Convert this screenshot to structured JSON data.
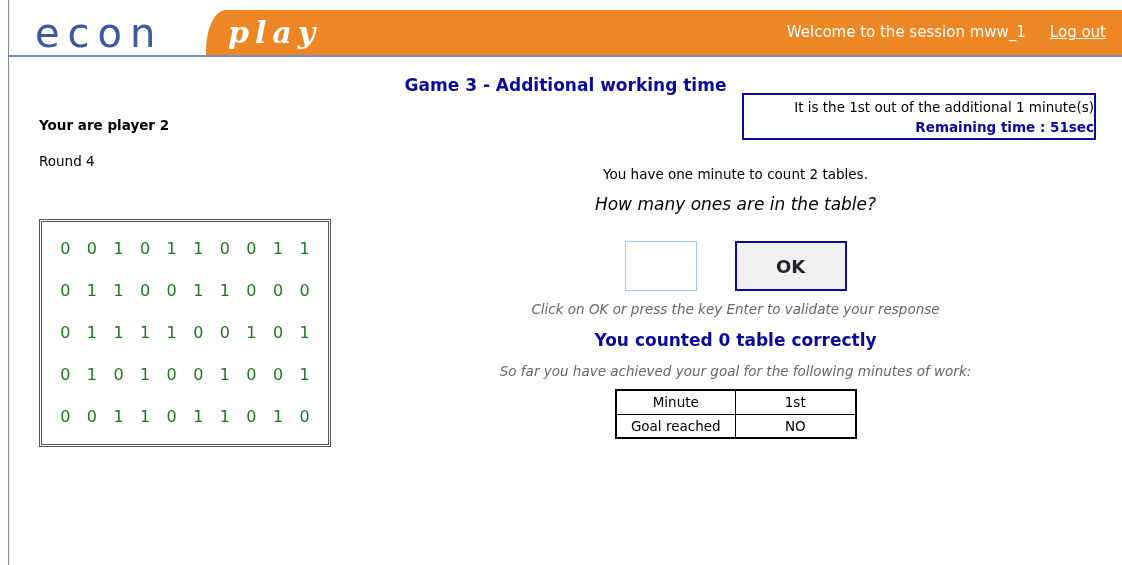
{
  "header": {
    "logo_left": "econ",
    "logo_right": "play",
    "welcome": "Welcome to the session mww_1",
    "logout": "Log out"
  },
  "title": "Game 3 - Additional working time",
  "player": "Your are player 2",
  "round": "Round 4",
  "matrix": [
    [
      "0",
      "0",
      "1",
      "0",
      "1",
      "1",
      "0",
      "0",
      "1",
      "1"
    ],
    [
      "0",
      "1",
      "1",
      "0",
      "0",
      "1",
      "1",
      "0",
      "0",
      "0"
    ],
    [
      "0",
      "1",
      "1",
      "1",
      "1",
      "0",
      "0",
      "1",
      "0",
      "1"
    ],
    [
      "0",
      "1",
      "0",
      "1",
      "0",
      "0",
      "1",
      "0",
      "0",
      "1"
    ],
    [
      "0",
      "0",
      "1",
      "1",
      "0",
      "1",
      "1",
      "0",
      "1",
      "0"
    ]
  ],
  "timer": {
    "info": "It is the 1st out of the additional 1 minute(s)",
    "remaining": "Remaining time : 51sec"
  },
  "instruction": "You have one minute to count 2 tables.",
  "question": "How many ones are in the table?",
  "ok_button": "OK",
  "hint": "Click on OK or press the key Enter to validate your response",
  "counted": "You counted 0 table correctly",
  "goal_text": "So far you have achieved your goal for the following minutes of work:",
  "goal_table": [
    [
      "Minute",
      "1st"
    ],
    [
      "Goal reached",
      "NO"
    ]
  ]
}
